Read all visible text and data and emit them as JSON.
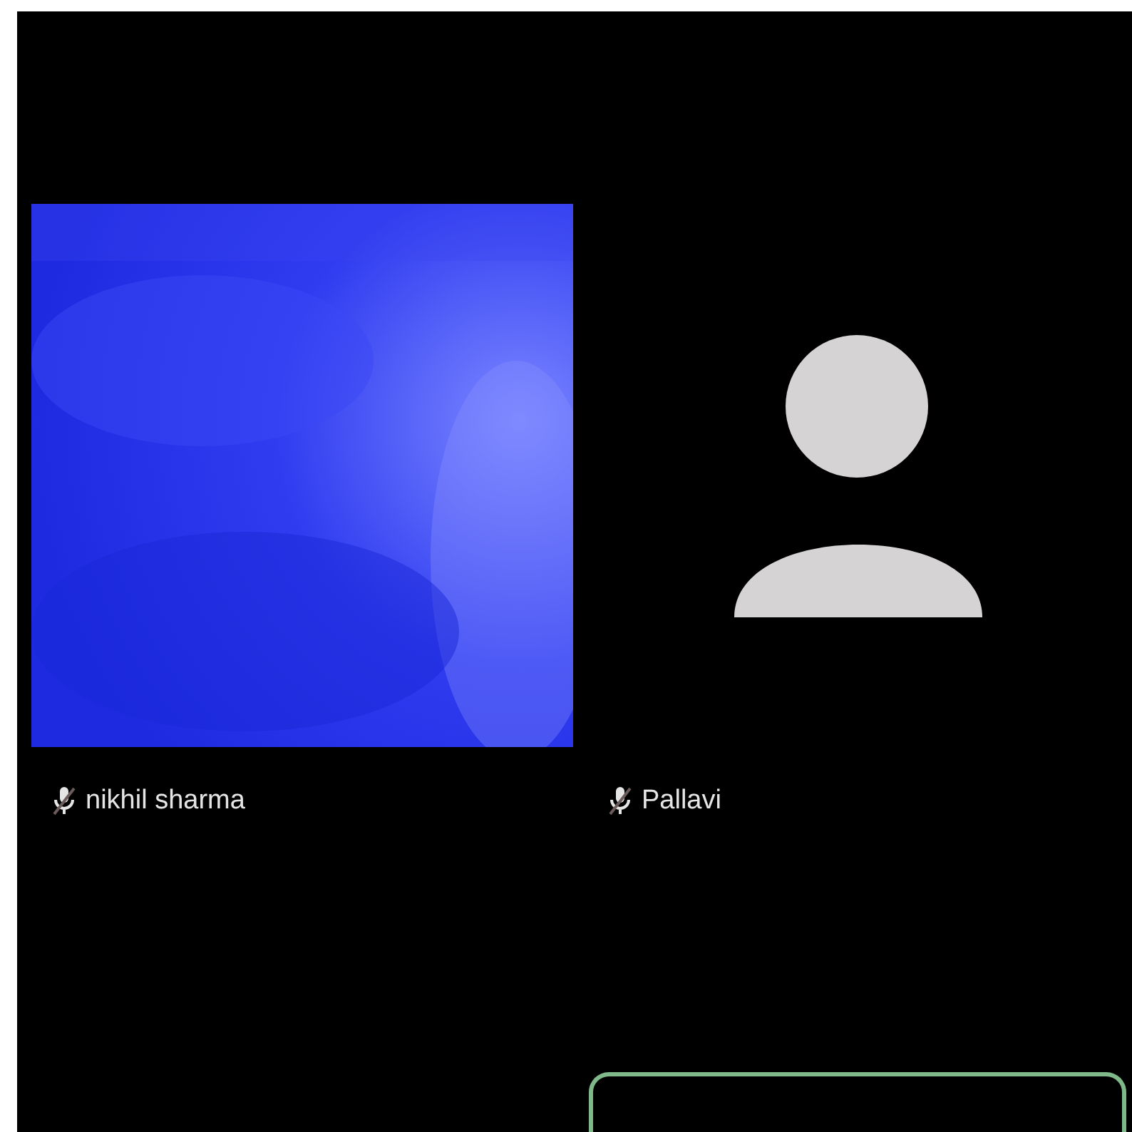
{
  "participants": [
    {
      "name": "nikhil sharma",
      "muted": true,
      "kind": "picture"
    },
    {
      "name": "Pallavi",
      "muted": true,
      "kind": "avatar"
    }
  ]
}
